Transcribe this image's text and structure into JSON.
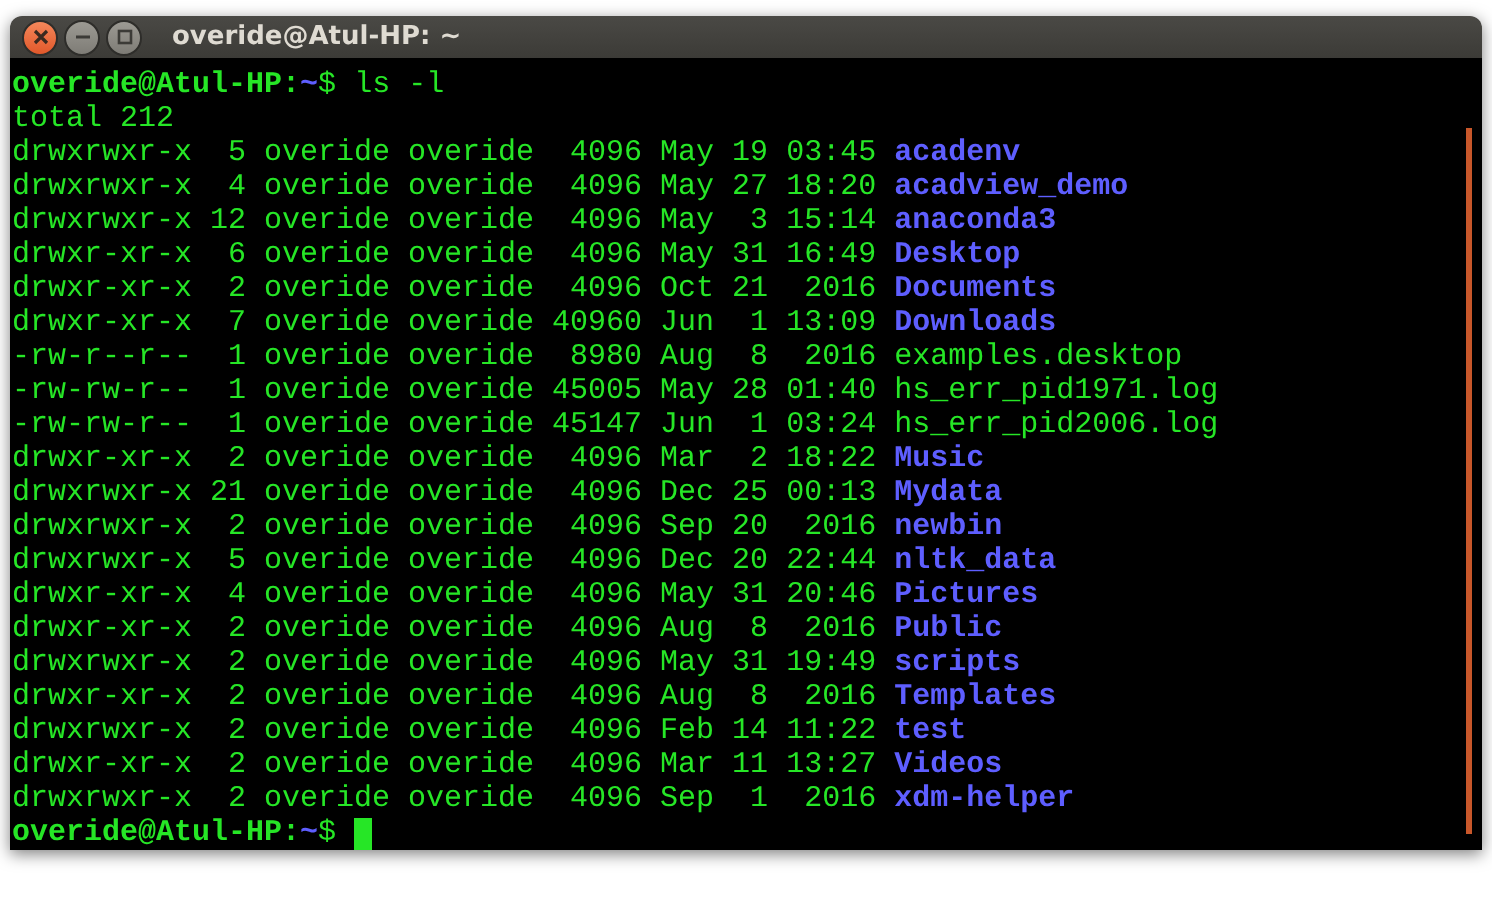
{
  "window": {
    "title": "overide@Atul-HP: ~"
  },
  "terminal": {
    "prompt": {
      "user_host": "overide@Atul-HP",
      "separator": ":",
      "path": "~",
      "symbol": "$"
    },
    "final_prompt": {
      "user_host": "overide@Atul-HP",
      "separator": ":",
      "path": "~",
      "symbol": "$"
    },
    "command": "ls -l",
    "total": "total 212",
    "rows": [
      {
        "details": "drwxrwxr-x  5 overide overide  4096 May 19 03:45",
        "name": "acadenv",
        "kind": "dir"
      },
      {
        "details": "drwxrwxr-x  4 overide overide  4096 May 27 18:20",
        "name": "acadview_demo",
        "kind": "dir"
      },
      {
        "details": "drwxrwxr-x 12 overide overide  4096 May  3 15:14",
        "name": "anaconda3",
        "kind": "dir"
      },
      {
        "details": "drwxr-xr-x  6 overide overide  4096 May 31 16:49",
        "name": "Desktop",
        "kind": "dir"
      },
      {
        "details": "drwxr-xr-x  2 overide overide  4096 Oct 21  2016",
        "name": "Documents",
        "kind": "dir"
      },
      {
        "details": "drwxr-xr-x  7 overide overide 40960 Jun  1 13:09",
        "name": "Downloads",
        "kind": "dir"
      },
      {
        "details": "-rw-r--r--  1 overide overide  8980 Aug  8  2016",
        "name": "examples.desktop",
        "kind": "file"
      },
      {
        "details": "-rw-rw-r--  1 overide overide 45005 May 28 01:40",
        "name": "hs_err_pid1971.log",
        "kind": "file"
      },
      {
        "details": "-rw-rw-r--  1 overide overide 45147 Jun  1 03:24",
        "name": "hs_err_pid2006.log",
        "kind": "file"
      },
      {
        "details": "drwxr-xr-x  2 overide overide  4096 Mar  2 18:22",
        "name": "Music",
        "kind": "dir"
      },
      {
        "details": "drwxrwxr-x 21 overide overide  4096 Dec 25 00:13",
        "name": "Mydata",
        "kind": "dir"
      },
      {
        "details": "drwxrwxr-x  2 overide overide  4096 Sep 20  2016",
        "name": "newbin",
        "kind": "dir"
      },
      {
        "details": "drwxrwxr-x  5 overide overide  4096 Dec 20 22:44",
        "name": "nltk_data",
        "kind": "dir"
      },
      {
        "details": "drwxr-xr-x  4 overide overide  4096 May 31 20:46",
        "name": "Pictures",
        "kind": "dir"
      },
      {
        "details": "drwxr-xr-x  2 overide overide  4096 Aug  8  2016",
        "name": "Public",
        "kind": "dir"
      },
      {
        "details": "drwxrwxr-x  2 overide overide  4096 May 31 19:49",
        "name": "scripts",
        "kind": "dir"
      },
      {
        "details": "drwxr-xr-x  2 overide overide  4096 Aug  8  2016",
        "name": "Templates",
        "kind": "dir"
      },
      {
        "details": "drwxrwxr-x  2 overide overide  4096 Feb 14 11:22",
        "name": "test",
        "kind": "dir"
      },
      {
        "details": "drwxr-xr-x  2 overide overide  4096 Mar 11 13:27",
        "name": "Videos",
        "kind": "dir"
      },
      {
        "details": "drwxrwxr-x  2 overide overide  4096 Sep  1  2016",
        "name": "xdm-helper",
        "kind": "dir"
      }
    ]
  }
}
